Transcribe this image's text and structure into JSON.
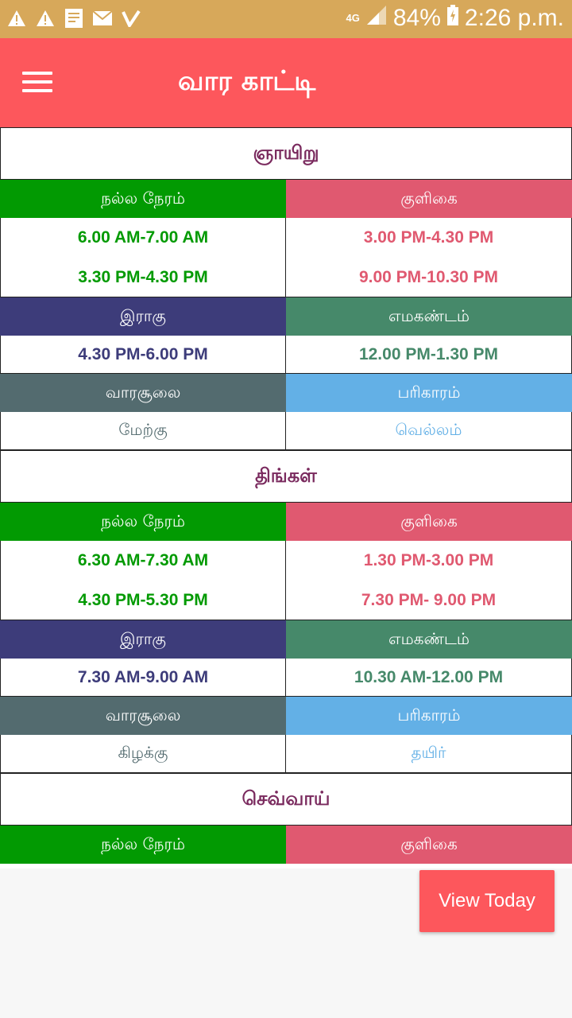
{
  "status_bar": {
    "icons": [
      "warning-icon",
      "warning-icon",
      "document-icon",
      "mail-icon",
      "check-icon"
    ],
    "network": "4G",
    "battery": "84%",
    "time": "2:26 p.m."
  },
  "toolbar": {
    "title": "வார காட்டி"
  },
  "labels": {
    "nalla_neram": "நல்ல நேரம்",
    "kuligai": "குளிகை",
    "ragu": "இராகு",
    "emagandam": "எமகண்டம்",
    "soolai": "வாரசூலை",
    "parigaram": "பரிகாரம்"
  },
  "colors": {
    "accent": "#fd575c",
    "status_bar": "#d7a85a",
    "nalla_neram": "#029a02",
    "kuligai": "#e05970",
    "ragu": "#3d3c7a",
    "emagandam": "#46896a",
    "soolai": "#536b6f",
    "parigaram": "#63b0e6"
  },
  "days": [
    {
      "name": "ஞாயிறு",
      "nalla_neram": [
        "6.00 AM-7.00 AM",
        "3.30 PM-4.30 PM"
      ],
      "kuligai": [
        "3.00 PM-4.30 PM",
        "9.00 PM-10.30 PM"
      ],
      "ragu": "4.30 PM-6.00 PM",
      "emagandam": "12.00 PM-1.30 PM",
      "soolai": "மேற்கு",
      "parigaram": "வெல்லம்"
    },
    {
      "name": "திங்கள்",
      "nalla_neram": [
        "6.30 AM-7.30 AM",
        "4.30 PM-5.30 PM"
      ],
      "kuligai": [
        "1.30 PM-3.00 PM",
        "7.30 PM- 9.00 PM"
      ],
      "ragu": "7.30 AM-9.00 AM",
      "emagandam": "10.30 AM-12.00 PM",
      "soolai": "கிழக்கு",
      "parigaram": "தயிர்"
    },
    {
      "name": "செவ்வாய்"
    }
  ],
  "fab": {
    "label": "View Today"
  }
}
